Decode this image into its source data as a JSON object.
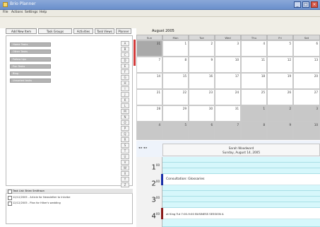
{
  "window": {
    "title": "Brio Planner",
    "controls": [
      "_",
      "□",
      "×"
    ]
  },
  "menus": [
    "File",
    "Actions",
    "Settings",
    "Help"
  ],
  "toolbar": {
    "add_item": "Add New Item",
    "task_group": "Task Groups",
    "activities": "Activities",
    "task_views": "Task Views",
    "planner": "Planner"
  },
  "left_list": [
    "Home Tasks",
    "Other Tasks",
    "Follow Ups",
    "Fun Tasks",
    "Blog",
    "Unsorted tasks"
  ],
  "side_icons": [
    "A",
    "B",
    "C",
    "D",
    "E",
    "F",
    "G",
    "H",
    "I",
    "J",
    "K",
    "L",
    "M",
    "N",
    "O",
    "P",
    "Q",
    "R",
    "S",
    "T",
    "U",
    "V",
    "W",
    "X",
    "Y",
    "Z"
  ],
  "tasks": {
    "header": "Task List: Brian Smithson",
    "items": [
      "12/12/2005 - Article for Newsletter to Inkvibe",
      "12/12/2005 - Plan for Hiker's wedding"
    ]
  },
  "calendar": {
    "month_label": "August 2005",
    "day_headers": [
      "Sun",
      "Mon",
      "Tue",
      "Wed",
      "Thu",
      "Fri",
      "Sat"
    ],
    "weeks": [
      [
        "31",
        "1",
        "2",
        "3",
        "4",
        "5",
        "6"
      ],
      [
        "7",
        "8",
        "9",
        "10",
        "11",
        "12",
        "13"
      ],
      [
        "14",
        "15",
        "16",
        "17",
        "18",
        "19",
        "20"
      ],
      [
        "21",
        "22",
        "23",
        "24",
        "25",
        "26",
        "27"
      ],
      [
        "28",
        "29",
        "30",
        "31",
        "1",
        "2",
        "3"
      ],
      [
        "4",
        "5",
        "6",
        "7",
        "8",
        "9",
        "10"
      ]
    ]
  },
  "dayview": {
    "title": "Sarah Woodward",
    "date": "Sunday, August 14, 2005",
    "hours": [
      "1",
      "2",
      "3",
      "4"
    ],
    "hour_suffix": "00",
    "events": {
      "consult": "Consultation: Glossaries",
      "lower": "at King Tut 7:00-9:00 BUSINESS SESSION A"
    },
    "accent": "#1a2fa8",
    "accent2": "#8b1a1a"
  }
}
